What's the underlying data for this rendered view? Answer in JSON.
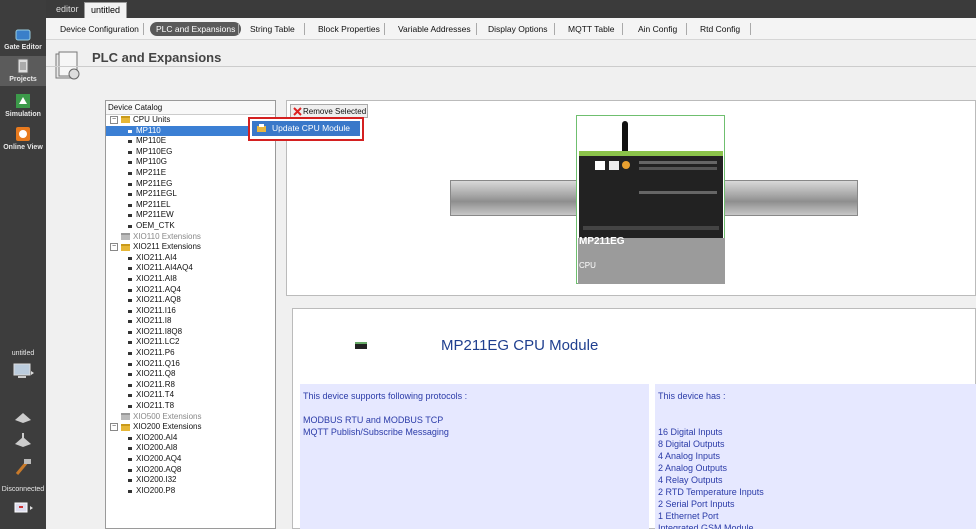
{
  "sidebar": {
    "items": [
      {
        "label": "Gate Editor",
        "icon": "gate-editor-icon"
      },
      {
        "label": "Projects",
        "icon": "projects-icon"
      },
      {
        "label": "Simulation",
        "icon": "simulation-icon"
      },
      {
        "label": "Online View",
        "icon": "online-view-icon"
      }
    ],
    "project_label": "untitled",
    "status_label": "Disconnected"
  },
  "doc_tabs": [
    "editor",
    "untitled"
  ],
  "nav_tabs": [
    "Device Configuration",
    "PLC and Expansions",
    "String Table",
    "Block Properties",
    "Variable Addresses",
    "Display Options",
    "MQTT  Table",
    "Ain Config",
    "Rtd Config"
  ],
  "page": {
    "title": "PLC and Expansions"
  },
  "catalog": {
    "title": "Device Catalog",
    "rows": [
      {
        "type": "cat",
        "label": "CPU Units",
        "exp": "−",
        "grey": false
      },
      {
        "type": "leaf",
        "label": "MP110",
        "selected": true
      },
      {
        "type": "leaf",
        "label": "MP110E"
      },
      {
        "type": "leaf",
        "label": "MP110EG"
      },
      {
        "type": "leaf",
        "label": "MP110G"
      },
      {
        "type": "leaf",
        "label": "MP211E"
      },
      {
        "type": "leaf",
        "label": "MP211EG"
      },
      {
        "type": "leaf",
        "label": "MP211EGL"
      },
      {
        "type": "leaf",
        "label": "MP211EL"
      },
      {
        "type": "leaf",
        "label": "MP211EW"
      },
      {
        "type": "leaf",
        "label": "OEM_CTK"
      },
      {
        "type": "cat",
        "label": "XIO110 Extensions",
        "exp": "",
        "grey": true
      },
      {
        "type": "cat",
        "label": "XIO211 Extensions",
        "exp": "−",
        "grey": false
      },
      {
        "type": "leaf",
        "label": "XIO211.AI4"
      },
      {
        "type": "leaf",
        "label": "XIO211.AI4AQ4"
      },
      {
        "type": "leaf",
        "label": "XIO211.AI8"
      },
      {
        "type": "leaf",
        "label": "XIO211.AQ4"
      },
      {
        "type": "leaf",
        "label": "XIO211.AQ8"
      },
      {
        "type": "leaf",
        "label": "XIO211.I16"
      },
      {
        "type": "leaf",
        "label": "XIO211.I8"
      },
      {
        "type": "leaf",
        "label": "XIO211.I8Q8"
      },
      {
        "type": "leaf",
        "label": "XIO211.LC2"
      },
      {
        "type": "leaf",
        "label": "XIO211.P6"
      },
      {
        "type": "leaf",
        "label": "XIO211.Q16"
      },
      {
        "type": "leaf",
        "label": "XIO211.Q8"
      },
      {
        "type": "leaf",
        "label": "XIO211.R8"
      },
      {
        "type": "leaf",
        "label": "XIO211.T4"
      },
      {
        "type": "leaf",
        "label": "XIO211.T8"
      },
      {
        "type": "cat",
        "label": "XIO500 Extensions",
        "exp": "",
        "grey": true
      },
      {
        "type": "cat",
        "label": "XIO200 Extensions",
        "exp": "−",
        "grey": false
      },
      {
        "type": "leaf",
        "label": "XIO200.AI4"
      },
      {
        "type": "leaf",
        "label": "XIO200.AI8"
      },
      {
        "type": "leaf",
        "label": "XIO200.AQ4"
      },
      {
        "type": "leaf",
        "label": "XIO200.AQ8"
      },
      {
        "type": "leaf",
        "label": "XIO200.I32"
      },
      {
        "type": "leaf",
        "label": "XIO200.P8"
      }
    ]
  },
  "toolbar": {
    "remove_label": "Remove Selected"
  },
  "context_menu": {
    "item_label": "Update CPU Module"
  },
  "device": {
    "name": "MP211EG",
    "sub": "CPU"
  },
  "info": {
    "title": "MP211EG CPU Module",
    "protocols_header": "This device supports following protocols :",
    "protocols": [
      "MODBUS RTU and MODBUS TCP",
      "MQTT  Publish/Subscribe Messaging"
    ],
    "features_header": "This device has :",
    "features": [
      "16 Digital Inputs",
      "8 Digital Outputs",
      "4 Analog Inputs",
      "2 Analog Outputs",
      "4 Relay Outputs",
      "2 RTD Temperature Inputs",
      "2 Serial Port Inputs",
      "1 Ethernet Port",
      "Integrated GSM Module"
    ]
  },
  "colors": {
    "accent": "#3a78c9",
    "highlight_border": "#d42020",
    "sidebar_bg": "#3d3d3d",
    "info_text": "#2b3ba8"
  }
}
